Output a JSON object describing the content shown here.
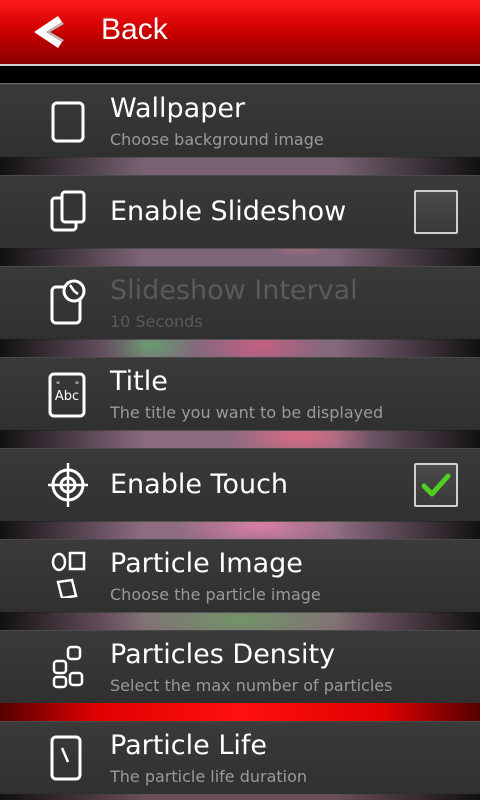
{
  "header": {
    "back_label": "Back"
  },
  "rows": [
    {
      "title": "Wallpaper",
      "subtitle": "Choose background image"
    },
    {
      "title": "Enable Slideshow",
      "checked": false
    },
    {
      "title": "Slideshow Interval",
      "subtitle": "10 Seconds",
      "enabled": false
    },
    {
      "title": "Title",
      "subtitle": "The title you want to be displayed"
    },
    {
      "title": "Enable Touch",
      "checked": true
    },
    {
      "title": "Particle Image",
      "subtitle": "Choose the particle image"
    },
    {
      "title": "Particles Density",
      "subtitle": "Select the max number of particles"
    },
    {
      "title": "Particle Life",
      "subtitle": "The particle life duration"
    }
  ],
  "colors": {
    "header_red": "#d00000",
    "check_green": "#4fcf20"
  }
}
